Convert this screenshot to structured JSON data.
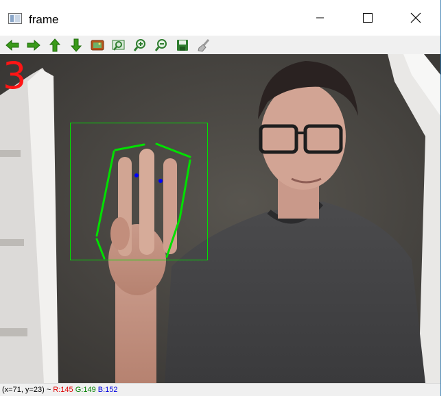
{
  "window": {
    "title": "frame",
    "controls": {
      "minimize": "minimize",
      "maximize": "maximize",
      "close": "close"
    }
  },
  "toolbar": {
    "buttons": [
      {
        "name": "pan-left",
        "icon": "arrow-left-icon",
        "color": "#3a9a1a"
      },
      {
        "name": "pan-right",
        "icon": "arrow-right-icon",
        "color": "#3a9a1a"
      },
      {
        "name": "pan-up",
        "icon": "arrow-up-icon",
        "color": "#3a9a1a"
      },
      {
        "name": "pan-down",
        "icon": "arrow-down-icon",
        "color": "#3a9a1a"
      },
      {
        "name": "zoom-original",
        "icon": "image-icon",
        "color": "#b5541a"
      },
      {
        "name": "zoom-fit",
        "icon": "zoom-image-icon",
        "color": "#2f7d2f"
      },
      {
        "name": "zoom-in",
        "icon": "zoom-in-icon",
        "color": "#2f7d2f"
      },
      {
        "name": "zoom-out",
        "icon": "zoom-out-icon",
        "color": "#2f7d2f"
      },
      {
        "name": "save",
        "icon": "save-icon",
        "color": "#2f7d2f"
      },
      {
        "name": "properties",
        "icon": "brush-icon",
        "color": "#8a8a8a"
      }
    ]
  },
  "overlay": {
    "finger_count": "3",
    "count_color": "#ff1515",
    "roi_color": "#00e000",
    "contour_color": "#00e000",
    "point_color": "#0000ff"
  },
  "status": {
    "coords": "(x=71, y=23) ~ ",
    "r": "R:145",
    "g": "G:149",
    "b": "B:152"
  }
}
